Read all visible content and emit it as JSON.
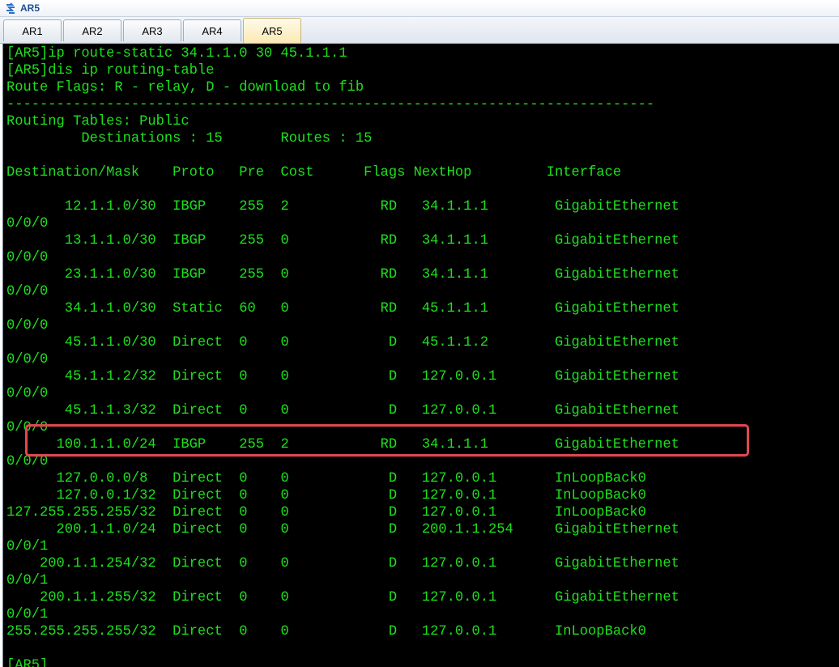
{
  "window": {
    "title": "AR5",
    "icon": "router-app-icon"
  },
  "tabs": [
    {
      "label": "AR1",
      "active": false
    },
    {
      "label": "AR2",
      "active": false
    },
    {
      "label": "AR3",
      "active": false
    },
    {
      "label": "AR4",
      "active": false
    },
    {
      "label": "AR5",
      "active": true
    }
  ],
  "terminal": {
    "text_color": "#1ee01e",
    "background": "#000000",
    "highlight_color": "#e0484e",
    "highlighted_line_index": 26,
    "lines": [
      "[AR5]ip route-static 34.1.1.0 30 45.1.1.1",
      "[AR5]dis ip routing-table",
      "Route Flags: R - relay, D - download to fib",
      "------------------------------------------------------------------------------",
      "Routing Tables: Public",
      "         Destinations : 15       Routes : 15",
      "",
      "Destination/Mask    Proto   Pre  Cost      Flags NextHop         Interface",
      "",
      "       12.1.1.0/30  IBGP    255  2           RD   34.1.1.1        GigabitEthernet",
      "0/0/0",
      "       13.1.1.0/30  IBGP    255  0           RD   34.1.1.1        GigabitEthernet",
      "0/0/0",
      "       23.1.1.0/30  IBGP    255  0           RD   34.1.1.1        GigabitEthernet",
      "0/0/0",
      "       34.1.1.0/30  Static  60   0           RD   45.1.1.1        GigabitEthernet",
      "0/0/0",
      "       45.1.1.0/30  Direct  0    0            D   45.1.1.2        GigabitEthernet",
      "0/0/0",
      "       45.1.1.2/32  Direct  0    0            D   127.0.0.1       GigabitEthernet",
      "0/0/0",
      "       45.1.1.3/32  Direct  0    0            D   127.0.0.1       GigabitEthernet",
      "0/0/0",
      "      100.1.1.0/24  IBGP    255  2           RD   34.1.1.1        GigabitEthernet",
      "0/0/0",
      "      127.0.0.0/8   Direct  0    0            D   127.0.0.1       InLoopBack0",
      "      127.0.0.1/32  Direct  0    0            D   127.0.0.1       InLoopBack0",
      "127.255.255.255/32  Direct  0    0            D   127.0.0.1       InLoopBack0",
      "      200.1.1.0/24  Direct  0    0            D   200.1.1.254     GigabitEthernet",
      "0/0/1",
      "    200.1.1.254/32  Direct  0    0            D   127.0.0.1       GigabitEthernet",
      "0/0/1",
      "    200.1.1.255/32  Direct  0    0            D   127.0.0.1       GigabitEthernet",
      "0/0/1",
      "255.255.255.255/32  Direct  0    0            D   127.0.0.1       InLoopBack0",
      "",
      "[AR5]"
    ]
  }
}
